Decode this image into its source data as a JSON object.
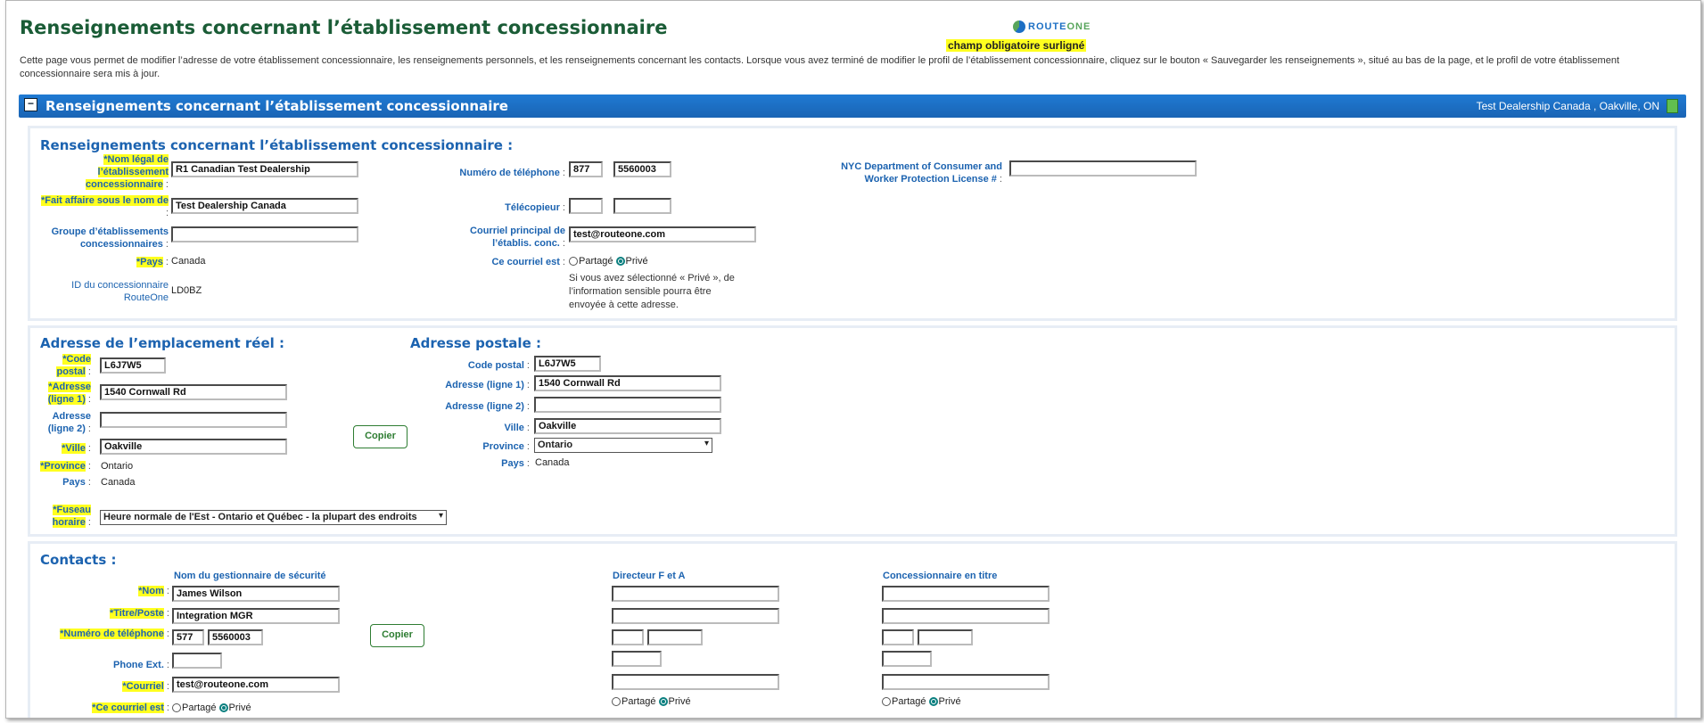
{
  "header": {
    "title": "Renseignements concernant l’établissement concessionnaire",
    "logo_route": "ROUTE",
    "logo_one": "ONE",
    "required_note": "champ obligatoire surligné",
    "intro": "Cette page vous permet de modifier l’adresse de votre établissement concessionnaire, les renseignements personnels, et les renseignements concernant les contacts. Lorsque vous avez terminé de modifier le profil de l’établissement concessionnaire, cliquez sur le bouton « Sauvegarder les renseignements », situé au bas de la page, et le profil de votre établissement concessionnaire sera mis à jour."
  },
  "banner": {
    "collapse_symbol": "−",
    "title": "Renseignements concernant l’établissement concessionnaire",
    "location": "Test Dealership Canada , Oakville, ON"
  },
  "dealer": {
    "section_title": "Renseignements concernant l’établissement concessionnaire :",
    "legal_name_label": "*Nom légal de l’établissement concessionnaire",
    "legal_name_value": "R1 Canadian Test Dealership",
    "dba_label": "*Fait affaire sous le nom de",
    "dba_value": "Test Dealership Canada",
    "group_label": "Groupe d’établissements concessionnaires",
    "group_value": "",
    "country_label": "*Pays",
    "country_value": "Canada",
    "dealer_id_label": "ID du concessionnaire RouteOne",
    "dealer_id_value": "LD0BZ",
    "phone_label": "Numéro de téléphone",
    "phone_area": "877",
    "phone_number": "5560003",
    "fax_label": "Télécopieur",
    "fax_area": "",
    "fax_number": "",
    "email_label": "Courriel principal de l’établis. conc.",
    "email_value": "test@routeone.com",
    "email_is_label": "Ce courriel est",
    "shared_label": "Partagé",
    "private_label": "Privé",
    "private_note": "Si vous avez sélectionné « Privé », de l’information sensible pourra être envoyée à cette adresse.",
    "nyc_label": "NYC Department of Consumer and Worker Protection License #",
    "nyc_value": ""
  },
  "physical": {
    "section_title": "Adresse de l’emplacement réel :",
    "postal_label": "*Code postal",
    "postal_value": "L6J7W5",
    "addr1_label": "*Adresse (ligne 1)",
    "addr1_value": "1540 Cornwall Rd",
    "addr2_label": "Adresse (ligne 2)",
    "addr2_value": "",
    "city_label": "*Ville",
    "city_value": "Oakville",
    "province_label": "*Province",
    "province_value": "Ontario",
    "country_label": "Pays",
    "country_value": "Canada",
    "tz_label": "*Fuseau horaire",
    "tz_value": "Heure normale de l'Est - Ontario et Québec - la plupart des endroits",
    "copy_button": "Copier"
  },
  "mailing": {
    "section_title": "Adresse postale :",
    "postal_label": "Code postal",
    "postal_value": "L6J7W5",
    "addr1_label": "Adresse (ligne 1)",
    "addr1_value": "1540 Cornwall Rd",
    "addr2_label": "Adresse (ligne 2)",
    "addr2_value": "",
    "city_label": "Ville",
    "city_value": "Oakville",
    "province_label": "Province",
    "province_value": "Ontario",
    "country_label": "Pays",
    "country_value": "Canada"
  },
  "contacts": {
    "section_title": "Contacts :",
    "col_security": "Nom du gestionnaire de sécurité",
    "col_fi": "Directeur F et A",
    "col_principal": "Concessionnaire en titre",
    "name_label": "*Nom",
    "title_label": "*Titre/Poste",
    "phone_label": "*Numéro de téléphone",
    "ext_label": "Phone Ext.",
    "email_label": "*Courriel",
    "email_is_label": "*Ce courriel est",
    "shared_label": "Partagé",
    "private_label": "Privé",
    "copy_button": "Copier",
    "security": {
      "name": "James Wilson",
      "title": "Integration MGR",
      "phone_area": "577",
      "phone_number": "5560003",
      "ext": "",
      "email": "test@routeone.com"
    }
  },
  "colors": {
    "title_green": "#1a5c36",
    "label_blue": "#1c63b0",
    "banner_blue": "#1f7ad3",
    "highlight_yellow": "#ffff1f"
  }
}
